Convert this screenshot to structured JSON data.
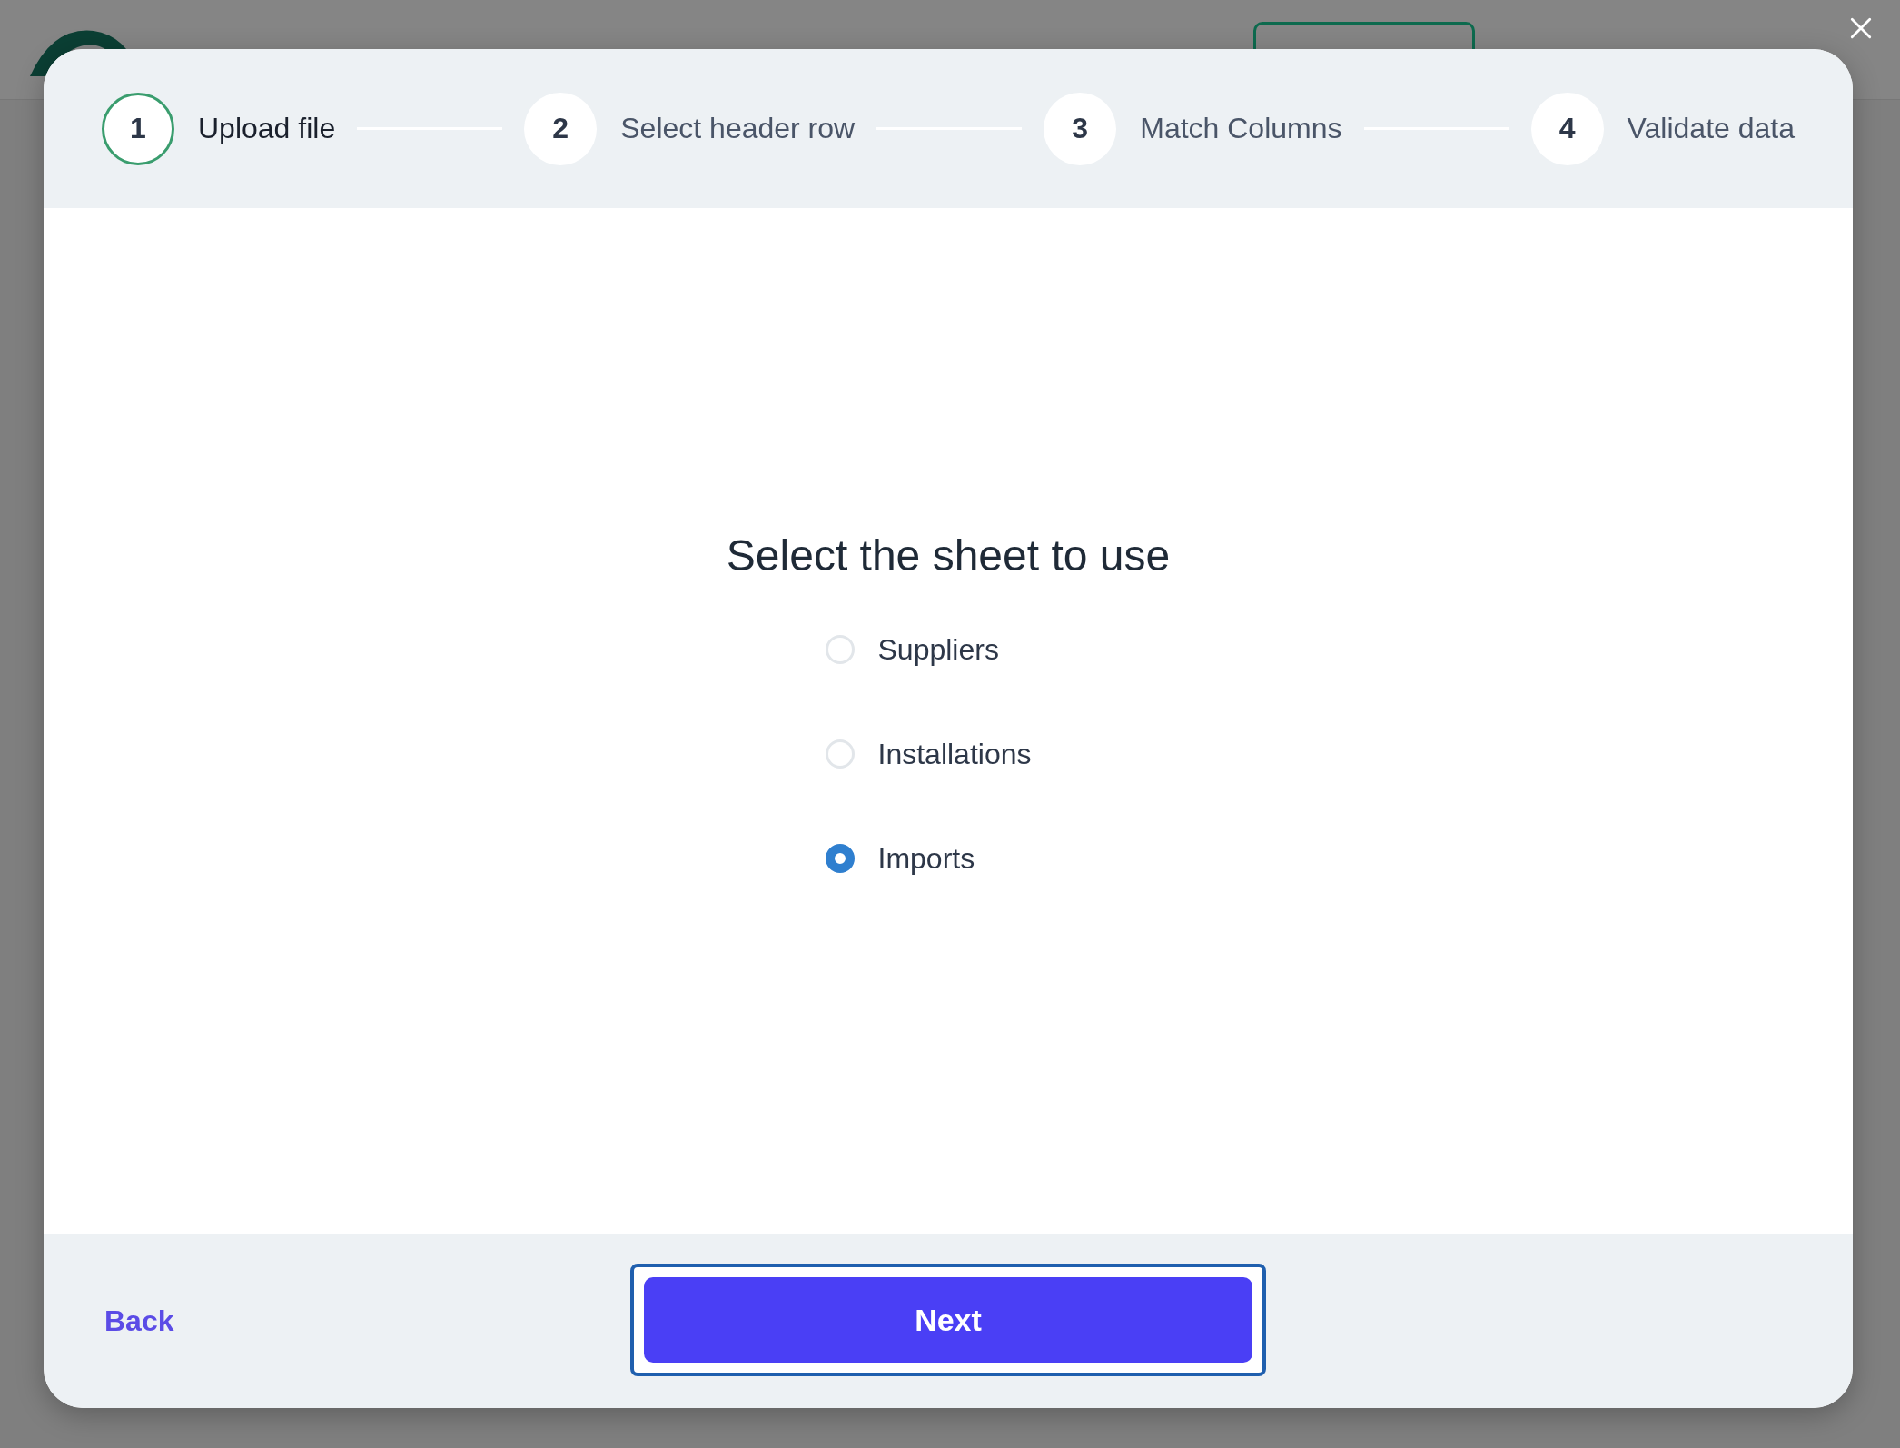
{
  "steps": [
    {
      "number": "1",
      "label": "Upload file",
      "selected": true
    },
    {
      "number": "2",
      "label": "Select header row",
      "selected": false
    },
    {
      "number": "3",
      "label": "Match Columns",
      "selected": false
    },
    {
      "number": "4",
      "label": "Validate data",
      "selected": false
    }
  ],
  "heading": "Select the sheet to use",
  "sheets": [
    {
      "label": "Suppliers",
      "selected": false
    },
    {
      "label": "Installations",
      "selected": false
    },
    {
      "label": "Imports",
      "selected": true
    }
  ],
  "footer": {
    "back": "Back",
    "next": "Next"
  }
}
